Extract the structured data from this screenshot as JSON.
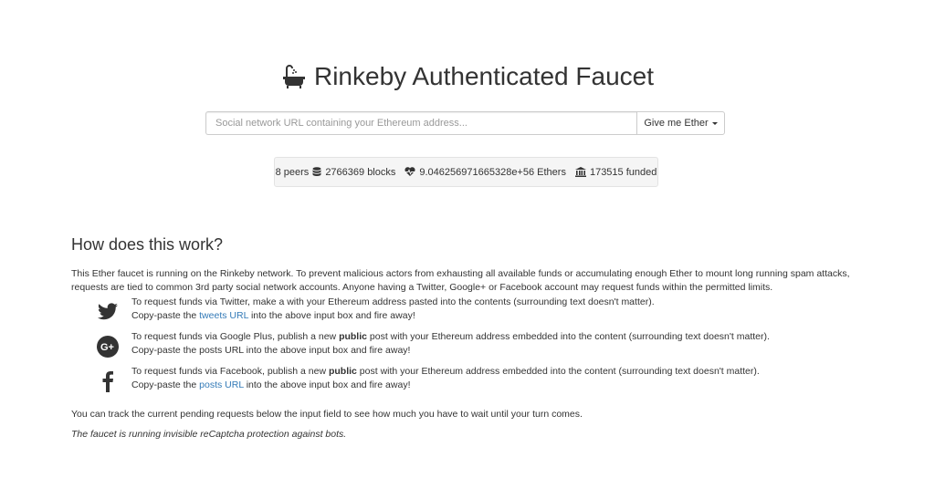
{
  "header": {
    "title": "Rinkeby Authenticated Faucet",
    "icon": "bathtub-icon"
  },
  "request": {
    "placeholder": "Social network URL containing your Ethereum address...",
    "value": "",
    "button_label": "Give me Ether"
  },
  "stats": {
    "peers": "8 peers",
    "blocks": "2766369 blocks",
    "ethers": "9.046256971665328e+56 Ethers",
    "funded": "173515 funded"
  },
  "info": {
    "heading": "How does this work?",
    "intro": "This Ether faucet is running on the Rinkeby network. To prevent malicious actors from exhausting all available funds or accumulating enough Ether to mount long running spam attacks, requests are tied to common 3rd party social network accounts. Anyone having a Twitter, Google+ or Facebook account may request funds within the permitted limits.",
    "twitter": {
      "line1": "To request funds via Twitter, make a with your Ethereum address pasted into the contents (surrounding text doesn't matter).",
      "line2_pre": "Copy-paste the ",
      "line2_link": "tweets URL",
      "line2_post": " into the above input box and fire away!"
    },
    "google": {
      "line1_pre": "To request funds via Google Plus, publish a new ",
      "line1_bold": "public",
      "line1_post": " post with your Ethereum address embedded into the content (surrounding text doesn't matter).",
      "line2": "Copy-paste the posts URL into the above input box and fire away!"
    },
    "facebook": {
      "line1_pre": "To request funds via Facebook, publish a new ",
      "line1_bold": "public",
      "line1_post": " post with your Ethereum address embedded into the content (surrounding text doesn't matter).",
      "line2_pre": "Copy-paste the ",
      "line2_link": "posts URL",
      "line2_post": " into the above input box and fire away!"
    },
    "track_note": "You can track the current pending requests below the input field to see how much you have to wait until your turn comes.",
    "captcha_note": "The faucet is running invisible reCaptcha protection against bots."
  },
  "colors": {
    "link": "#337ab7",
    "text": "#333333",
    "stats_bg": "#f5f5f5"
  }
}
